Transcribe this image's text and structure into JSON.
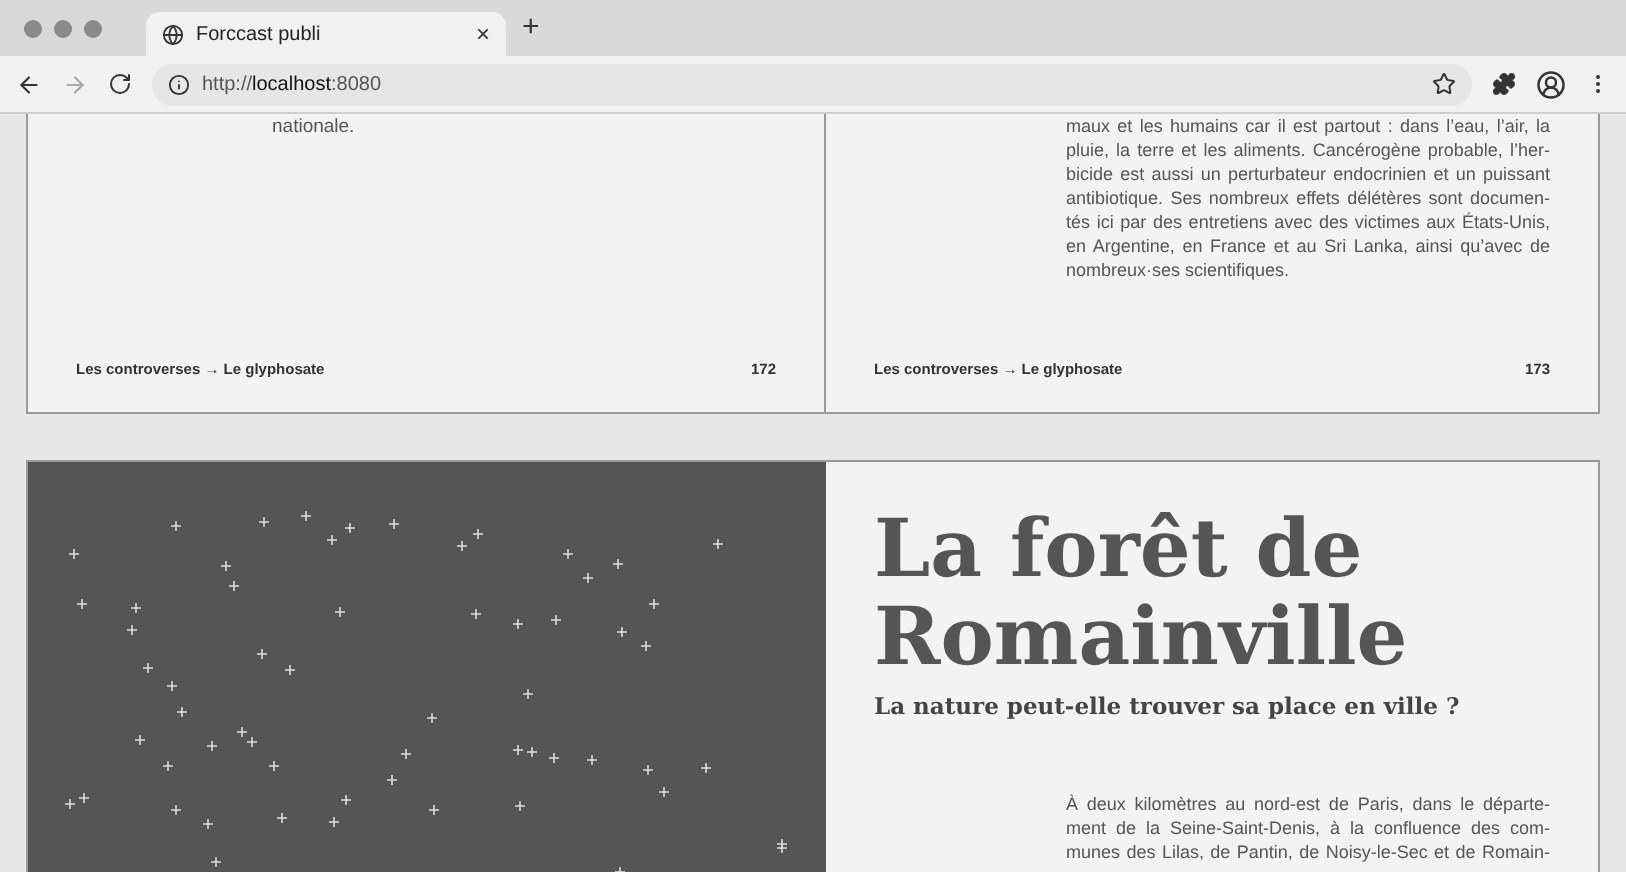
{
  "browser": {
    "tab_title": "Forccast publi",
    "tab_close": "×",
    "new_tab": "+",
    "url_scheme": "http://",
    "url_host": "localhost",
    "url_port": ":8080"
  },
  "top_spread": {
    "left_page": {
      "text": "nationale.",
      "footer_path": "Les controverses → Le glyphosate",
      "page_number": "172"
    },
    "right_page": {
      "lines": [
        "maux et les humains car il est partout : dans l’eau, l’air, la",
        "pluie, la terre et les aliments. Cancérogène probable, l’her-",
        "bicide est aussi un perturbateur endocrinien et un puissant",
        "antibiotique. Ses nombreux effets délétères sont documen-",
        "tés ici par des entretiens avec des victimes aux États-Unis,",
        "en Argentine, en France et au Sri Lanka, ainsi qu’avec de",
        "nombreux·ses scientifiques."
      ],
      "footer_path": "Les controverses → Le glyphosate",
      "page_number": "173"
    }
  },
  "bottom_spread": {
    "title": "La forêt de Romainville",
    "subtitle": "La nature peut-elle trouver sa place en ville ?",
    "body_lines": [
      "À deux kilomètres au nord-est de Paris, dans le départe-",
      "ment de la Seine-Saint-Denis, à la confluence des com-",
      "munes des Lilas, de Pantin, de Noisy-le-Sec et de Romain-"
    ]
  }
}
